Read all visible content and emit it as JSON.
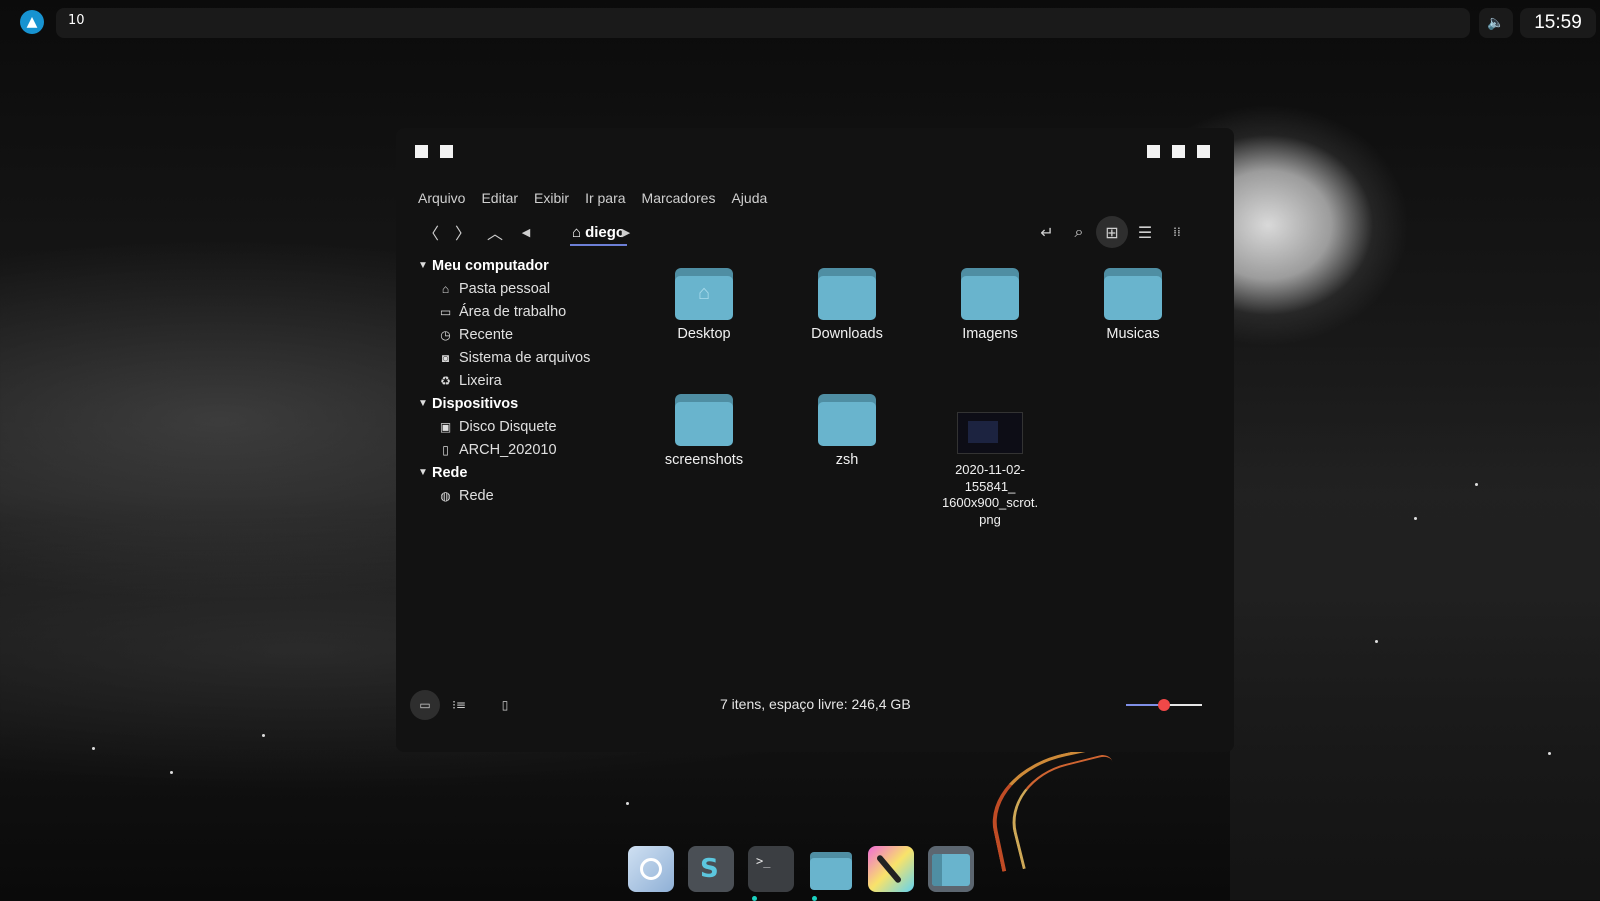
{
  "panel": {
    "workspace": "10",
    "clock": "15:59",
    "launcher_icon": "arch-logo-icon",
    "volume_icon": "speaker-icon"
  },
  "window": {
    "left_buttons": [
      "square-button",
      "square-button"
    ],
    "right_buttons": [
      "minimize-button",
      "maximize-button",
      "close-button"
    ],
    "menu": [
      "Arquivo",
      "Editar",
      "Exibir",
      "Ir para",
      "Marcadores",
      "Ajuda"
    ],
    "breadcrumb": "diego",
    "toolbar_icons": [
      "back-icon",
      "forward-icon",
      "up-icon",
      "prev-crumb-icon",
      "next-crumb-icon",
      "location-toggle-icon",
      "search-icon",
      "grid-view-icon",
      "list-view-icon",
      "compact-view-icon"
    ]
  },
  "sidebar": {
    "sections": [
      {
        "title": "Meu computador",
        "items": [
          {
            "label": "Pasta pessoal",
            "icon": "home-icon"
          },
          {
            "label": "Área de trabalho",
            "icon": "desktop-icon"
          },
          {
            "label": "Recente",
            "icon": "recent-icon"
          },
          {
            "label": "Sistema de arquivos",
            "icon": "filesystem-icon"
          },
          {
            "label": "Lixeira",
            "icon": "trash-icon"
          }
        ]
      },
      {
        "title": "Dispositivos",
        "items": [
          {
            "label": "Disco Disquete",
            "icon": "floppy-icon"
          },
          {
            "label": "ARCH_202010",
            "icon": "usb-drive-icon"
          }
        ]
      },
      {
        "title": "Rede",
        "items": [
          {
            "label": "Rede",
            "icon": "network-icon"
          }
        ]
      }
    ]
  },
  "files": [
    {
      "name": "Desktop",
      "type": "folder",
      "glyph": "home"
    },
    {
      "name": "Downloads",
      "type": "folder"
    },
    {
      "name": "Imagens",
      "type": "folder"
    },
    {
      "name": "Musicas",
      "type": "folder"
    },
    {
      "name": "screenshots",
      "type": "folder"
    },
    {
      "name": "zsh",
      "type": "folder"
    },
    {
      "name_lines": [
        "2020-11-02-",
        "155841_",
        "1600x900_scrot.",
        "png"
      ],
      "type": "image"
    }
  ],
  "statusbar": {
    "text": "7 itens, espaço livre: 246,4 GB",
    "zoom_fraction": 0.5,
    "buttons": [
      "places-icon",
      "tree-icon",
      "hide-sidebar-icon"
    ]
  },
  "dock": {
    "apps": [
      "chromium-icon",
      "sublime-text-icon",
      "terminal-icon",
      "file-manager-icon",
      "krita-icon",
      "window-manager-icon"
    ]
  },
  "colors": {
    "folder_front": "#69b4cd",
    "folder_back": "#4f8ea3",
    "accent": "#6d7fd6",
    "zoom_knob": "#f04848"
  }
}
